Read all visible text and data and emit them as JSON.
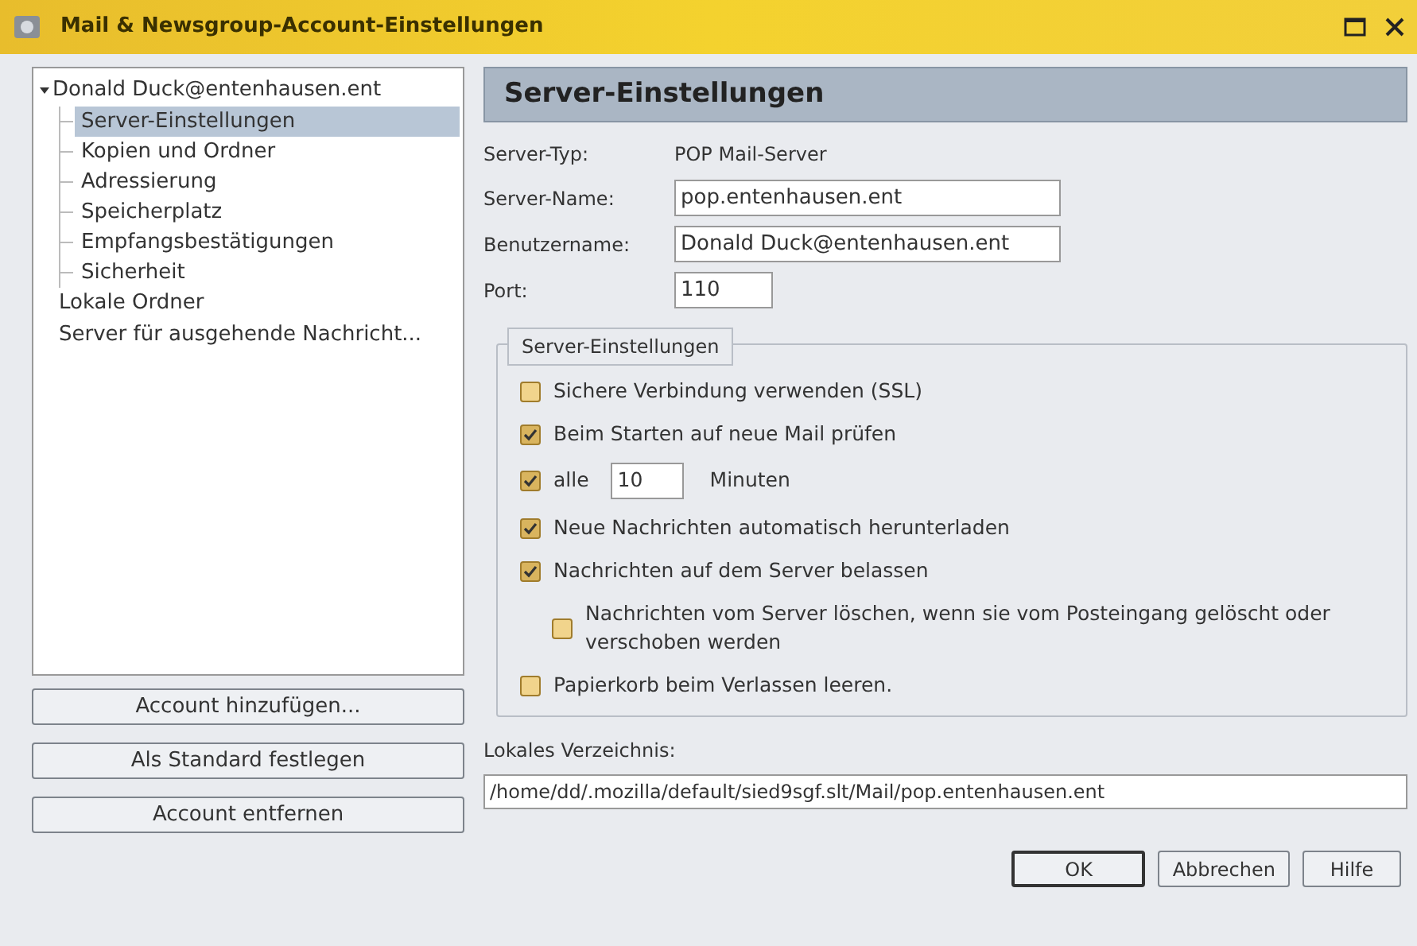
{
  "window": {
    "title": "Mail & Newsgroup-Account-Einstellungen"
  },
  "tree": [
    {
      "label": "Donald Duck@entenhausen.ent",
      "selected": false,
      "expanded": true,
      "children": [
        {
          "label": "Server-Einstellungen",
          "selected": true
        },
        {
          "label": "Kopien und Ordner",
          "selected": false
        },
        {
          "label": "Adressierung",
          "selected": false
        },
        {
          "label": "Speicherplatz",
          "selected": false
        },
        {
          "label": "Empfangsbestätigungen",
          "selected": false
        },
        {
          "label": "Sicherheit",
          "selected": false
        }
      ]
    },
    {
      "label": "Lokale Ordner",
      "selected": false
    },
    {
      "label": "Server für ausgehende Nachricht...",
      "selected": false
    }
  ],
  "account_buttons": [
    "Account hinzufügen...",
    "Als Standard festlegen",
    "Account entfernen"
  ],
  "panel": {
    "title": "Server-Einstellungen",
    "server_type": {
      "label": "Server-Typ:",
      "value": "POP Mail-Server"
    },
    "fields": [
      {
        "label": "Server-Name:",
        "value": "pop.entenhausen.ent",
        "kind": "wide"
      },
      {
        "label": "Benutzername:",
        "value": "Donald Duck@entenhausen.ent",
        "kind": "wide"
      },
      {
        "label": "Port:",
        "value": "110",
        "kind": "narrow"
      }
    ],
    "group": {
      "title": "Server-Einstellungen",
      "options": [
        {
          "kind": "checkbox",
          "label": "Sichere Verbindung verwenden (SSL)",
          "checked": false
        },
        {
          "kind": "checkbox",
          "label": "Beim Starten auf neue Mail prüfen",
          "checked": true
        },
        {
          "kind": "interval",
          "label": "alle",
          "value": "10",
          "unit": "Minuten",
          "checked": true
        },
        {
          "kind": "checkbox",
          "label": "Neue Nachrichten automatisch herunterladen",
          "checked": true
        },
        {
          "kind": "checkbox",
          "label": "Nachrichten auf dem Server belassen",
          "checked": true,
          "children": [
            {
              "kind": "checkbox",
              "label": "Nachrichten vom Server löschen, wenn sie vom Posteingang gelöscht oder verschoben werden",
              "checked": false
            }
          ]
        },
        {
          "kind": "checkbox",
          "label": "Papierkorb beim Verlassen leeren.",
          "checked": false
        }
      ]
    },
    "local_dir": {
      "label": "Lokales Verzeichnis:",
      "value": "/home/dd/.mozilla/default/sied9sgf.slt/Mail/pop.entenhausen.ent"
    }
  },
  "dialog_buttons": [
    {
      "label": "OK",
      "default": true
    },
    {
      "label": "Abbrechen",
      "default": false
    },
    {
      "label": "Hilfe",
      "default": false
    }
  ]
}
